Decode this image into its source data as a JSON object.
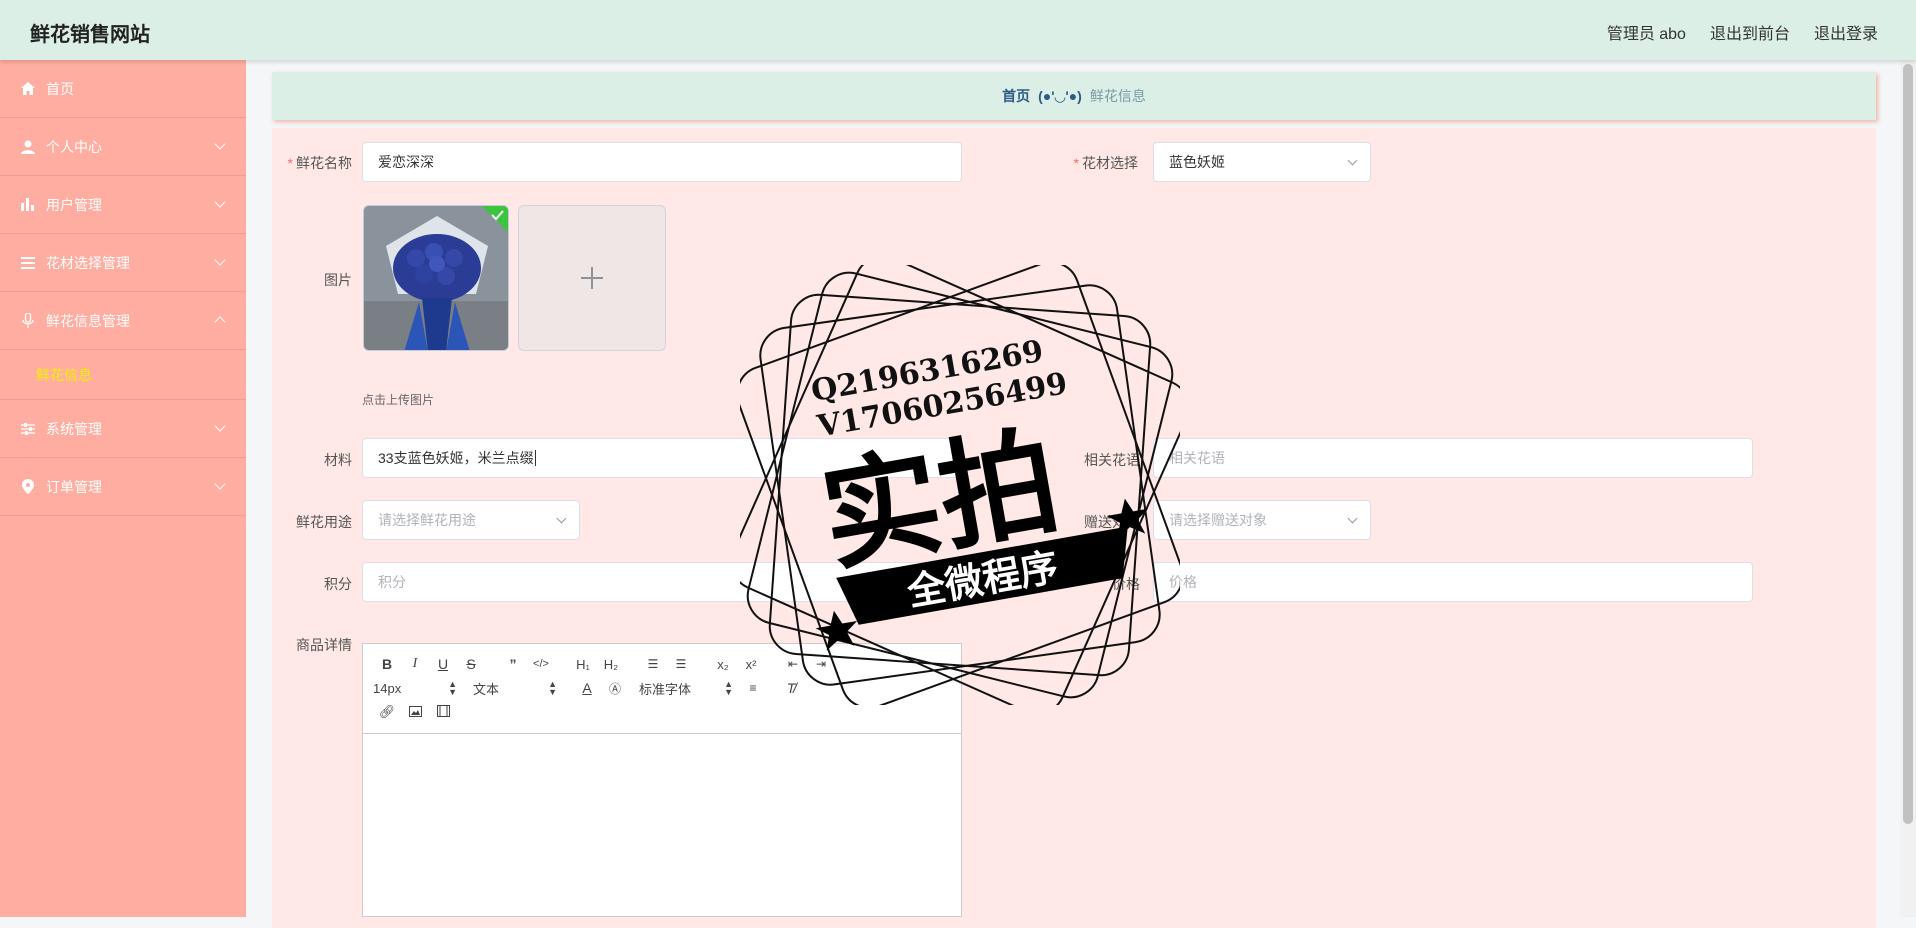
{
  "header": {
    "title": "鲜花销售网站",
    "admin_label": "管理员 abo",
    "front_link": "退出到前台",
    "logout_link": "退出登录"
  },
  "sidebar": {
    "items": [
      {
        "label": "首页",
        "icon": "home-icon"
      },
      {
        "label": "个人中心",
        "icon": "user-icon"
      },
      {
        "label": "用户管理",
        "icon": "bar-chart-icon"
      },
      {
        "label": "花材选择管理",
        "icon": "list-icon"
      },
      {
        "label": "鲜花信息管理",
        "icon": "microphone-icon"
      },
      {
        "label": "系统管理",
        "icon": "sliders-icon"
      },
      {
        "label": "订单管理",
        "icon": "location-icon"
      }
    ],
    "sub_active": "鲜花信息"
  },
  "breadcrumb": {
    "home": "首页",
    "separator": "(●'◡'●)",
    "current": "鲜花信息"
  },
  "form": {
    "name_label": "鲜花名称",
    "name_value": "爱恋深深",
    "material_choice_label": "花材选择",
    "material_choice_value": "蓝色妖姬",
    "image_label": "图片",
    "upload_hint": "点击上传图片",
    "material_label": "材料",
    "material_value": "33支蓝色妖姬，米兰点缀",
    "flower_language_label": "相关花语",
    "flower_language_placeholder": "相关花语",
    "usage_label": "鲜花用途",
    "usage_placeholder": "请选择鲜花用途",
    "recipient_label": "赠送对象",
    "recipient_placeholder": "请选择赠送对象",
    "points_label": "积分",
    "points_placeholder": "积分",
    "price_label": "价格",
    "price_placeholder": "价格",
    "detail_label": "商品详情"
  },
  "editor": {
    "font_size": "14px",
    "header_select": "文本",
    "font_family": "标准字体"
  },
  "watermark": {
    "line1": "Q2196316269",
    "line2": "V17060256499",
    "big": "实拍",
    "banner": "全微程序"
  },
  "colors": {
    "topbar": "#dcefe6",
    "sidebar": "#ffada0",
    "active_sub": "#f2f200",
    "form_bg": "#ffe8e5"
  }
}
